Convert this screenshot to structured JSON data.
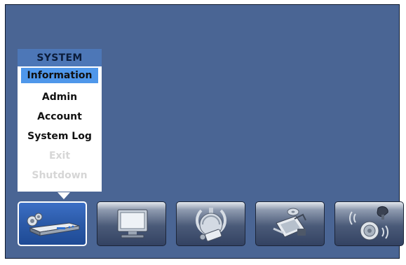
{
  "menu": {
    "header": "SYSTEM",
    "items": [
      {
        "label": "Information",
        "state": "selected"
      },
      {
        "label": "Admin",
        "state": "enabled"
      },
      {
        "label": "Account",
        "state": "enabled"
      },
      {
        "label": "System Log",
        "state": "enabled"
      },
      {
        "label": "Exit",
        "state": "disabled"
      },
      {
        "label": "Shutdown",
        "state": "disabled"
      }
    ]
  },
  "tabs": [
    {
      "icon": "dvr-system-icon",
      "active": true
    },
    {
      "icon": "monitor-icon",
      "active": false
    },
    {
      "icon": "camera-icon",
      "active": false
    },
    {
      "icon": "disk-recording-icon",
      "active": false
    },
    {
      "icon": "alarm-audio-icon",
      "active": false
    }
  ],
  "colors": {
    "background": "#4a6594",
    "menu_header": "#4d77b7",
    "selected_item": "#4f97ea",
    "active_tab": "#2b5aa8"
  }
}
